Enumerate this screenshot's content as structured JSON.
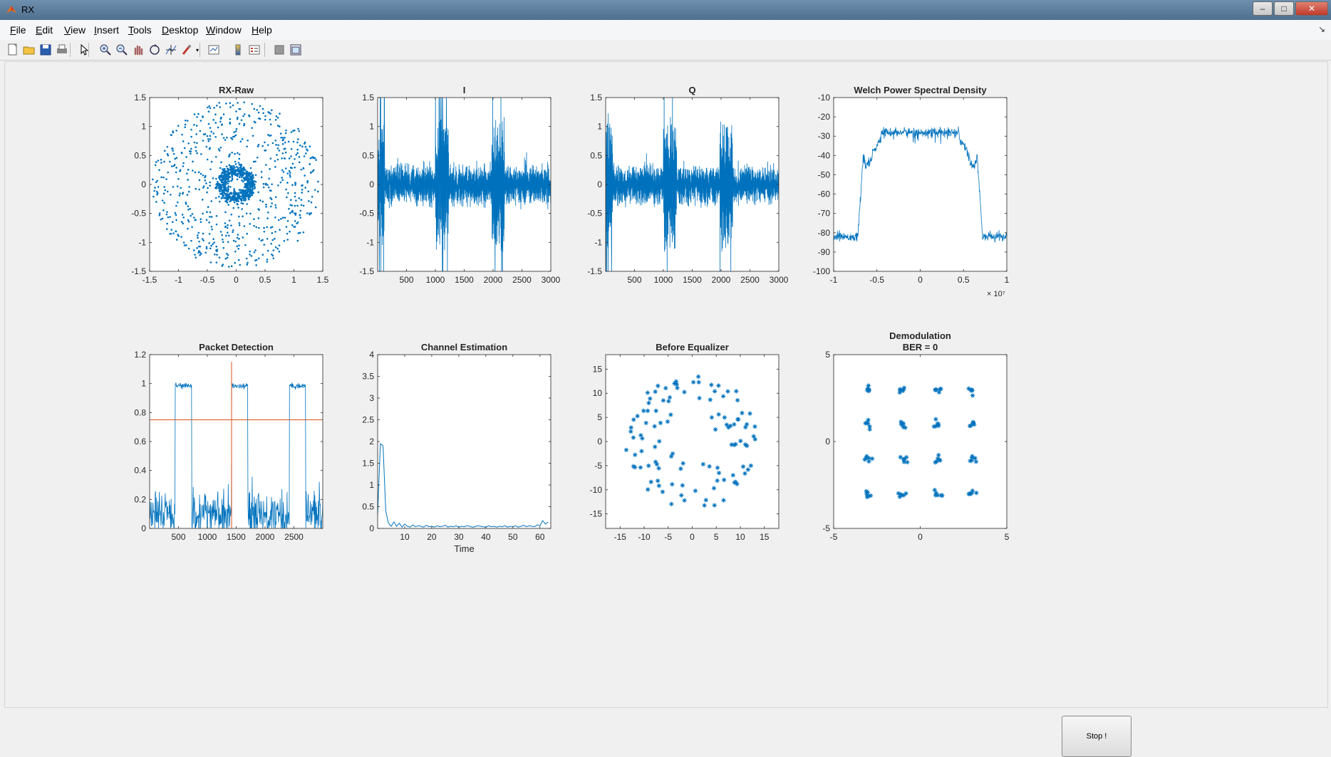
{
  "window": {
    "title": "RX"
  },
  "menu": [
    {
      "label": "File",
      "key": "F",
      "rest": "ile"
    },
    {
      "label": "Edit",
      "key": "E",
      "rest": "dit"
    },
    {
      "label": "View",
      "key": "V",
      "rest": "iew"
    },
    {
      "label": "Insert",
      "key": "I",
      "rest": "nsert"
    },
    {
      "label": "Tools",
      "key": "T",
      "rest": "ools"
    },
    {
      "label": "Desktop",
      "key": "D",
      "rest": "esktop"
    },
    {
      "label": "Window",
      "key": "W",
      "rest": "indow"
    },
    {
      "label": "Help",
      "key": "H",
      "rest": "elp"
    }
  ],
  "toolbar": [
    "new-file-icon",
    "open-folder-icon",
    "save-icon",
    "print-icon",
    "pointer-icon",
    "zoom-in-icon",
    "zoom-out-icon",
    "pan-icon",
    "rotate-icon",
    "data-cursor-icon",
    "brush-icon",
    "link-plot-icon",
    "colorbar-icon",
    "legend-icon",
    "hide-plot-tools-icon",
    "show-plot-tools-icon"
  ],
  "stop_button": {
    "label": "Stop !"
  },
  "colors": {
    "series": "#0072bd",
    "threshold": "#d95319"
  },
  "chart_data": [
    {
      "id": "rx-raw",
      "type": "scatter",
      "title": "RX-Raw",
      "xlim": [
        -1.5,
        1.5
      ],
      "ylim": [
        -1.5,
        1.5
      ],
      "xticks": [
        "-1.5",
        "-1",
        "-0.5",
        "0",
        "0.5",
        "1",
        "1.5"
      ],
      "yticks": [
        "1.5",
        "1",
        "0.5",
        "0",
        "-0.5",
        "-1",
        "-1.5"
      ],
      "marker": "dot"
    },
    {
      "id": "i",
      "type": "line",
      "title": "I",
      "xlim": [
        0,
        3000
      ],
      "ylim": [
        -1.5,
        1.5
      ],
      "xticks": [
        "500",
        "1000",
        "1500",
        "2000",
        "2500",
        "3000"
      ],
      "yticks": [
        "1.5",
        "1",
        "0.5",
        "0",
        "-0.5",
        "-1",
        "-1.5"
      ]
    },
    {
      "id": "q",
      "type": "line",
      "title": "Q",
      "xlim": [
        0,
        3000
      ],
      "ylim": [
        -1.5,
        1.5
      ],
      "xticks": [
        "500",
        "1000",
        "1500",
        "2000",
        "2500",
        "3000"
      ],
      "yticks": [
        "1.5",
        "1",
        "0.5",
        "0",
        "-0.5",
        "-1",
        "-1.5"
      ]
    },
    {
      "id": "psd",
      "type": "line",
      "title": "Welch Power Spectral Density",
      "xlim": [
        -1,
        1
      ],
      "ylim": [
        -100,
        -10
      ],
      "xexp": "× 10⁷",
      "xticks": [
        "-1",
        "-0.5",
        "0",
        "0.5",
        "1"
      ],
      "yticks": [
        "-10",
        "-20",
        "-30",
        "-40",
        "-50",
        "-60",
        "-70",
        "-80",
        "-90",
        "-100"
      ]
    },
    {
      "id": "packet",
      "type": "line",
      "title": "Packet Detection",
      "xlim": [
        0,
        3000
      ],
      "ylim": [
        0,
        1.2
      ],
      "threshold": 0.75,
      "detect_x": 1420,
      "xticks": [
        "500",
        "1000",
        "1500",
        "2000",
        "2500"
      ],
      "yticks": [
        "1.2",
        "1",
        "0.8",
        "0.6",
        "0.4",
        "0.2",
        "0"
      ]
    },
    {
      "id": "chan",
      "type": "line",
      "title": "Channel Estimation",
      "xlabel": "Time",
      "xlim": [
        0,
        64
      ],
      "ylim": [
        0,
        4
      ],
      "xticks": [
        "10",
        "20",
        "30",
        "40",
        "50",
        "60"
      ],
      "yticks": [
        "4",
        "3.5",
        "3",
        "2.5",
        "2",
        "1.5",
        "1",
        "0.5",
        "0"
      ],
      "values": [
        0.3,
        1.95,
        1.9,
        0.4,
        0.12,
        0.05,
        0.15,
        0.05,
        0.12,
        0.03,
        0.1,
        0.05,
        0.03,
        0.08,
        0.04,
        0.06,
        0.05,
        0.03,
        0.07,
        0.04,
        0.05,
        0.03,
        0.06,
        0.04,
        0.05,
        0.07,
        0.03,
        0.05,
        0.04,
        0.06,
        0.03,
        0.05,
        0.04,
        0.06,
        0.05,
        0.03,
        0.04,
        0.06,
        0.05,
        0.04,
        0.03,
        0.06,
        0.04,
        0.05,
        0.03,
        0.05,
        0.04,
        0.06,
        0.03,
        0.05,
        0.04,
        0.06,
        0.03,
        0.05,
        0.07,
        0.04,
        0.06,
        0.05,
        0.04,
        0.08,
        0.06,
        0.18,
        0.1,
        0.15
      ]
    },
    {
      "id": "before-eq",
      "type": "scatter",
      "title": "Before Equalizer",
      "xlim": [
        -18,
        18
      ],
      "ylim": [
        -18,
        18
      ],
      "xticks": [
        "-15",
        "-10",
        "-5",
        "0",
        "5",
        "10",
        "15"
      ],
      "yticks": [
        "15",
        "10",
        "5",
        "0",
        "-5",
        "-10",
        "-15"
      ],
      "marker": "asterisk"
    },
    {
      "id": "demod",
      "type": "scatter",
      "title": "Demodulation",
      "subtitle": "BER = 0",
      "xlim": [
        -5,
        5
      ],
      "ylim": [
        -5,
        5
      ],
      "xticks": [
        "-5",
        "0",
        "5"
      ],
      "yticks": [
        "5",
        "0",
        "-5"
      ],
      "marker": "asterisk",
      "constellation": [
        -3,
        -1,
        1,
        3
      ]
    }
  ]
}
